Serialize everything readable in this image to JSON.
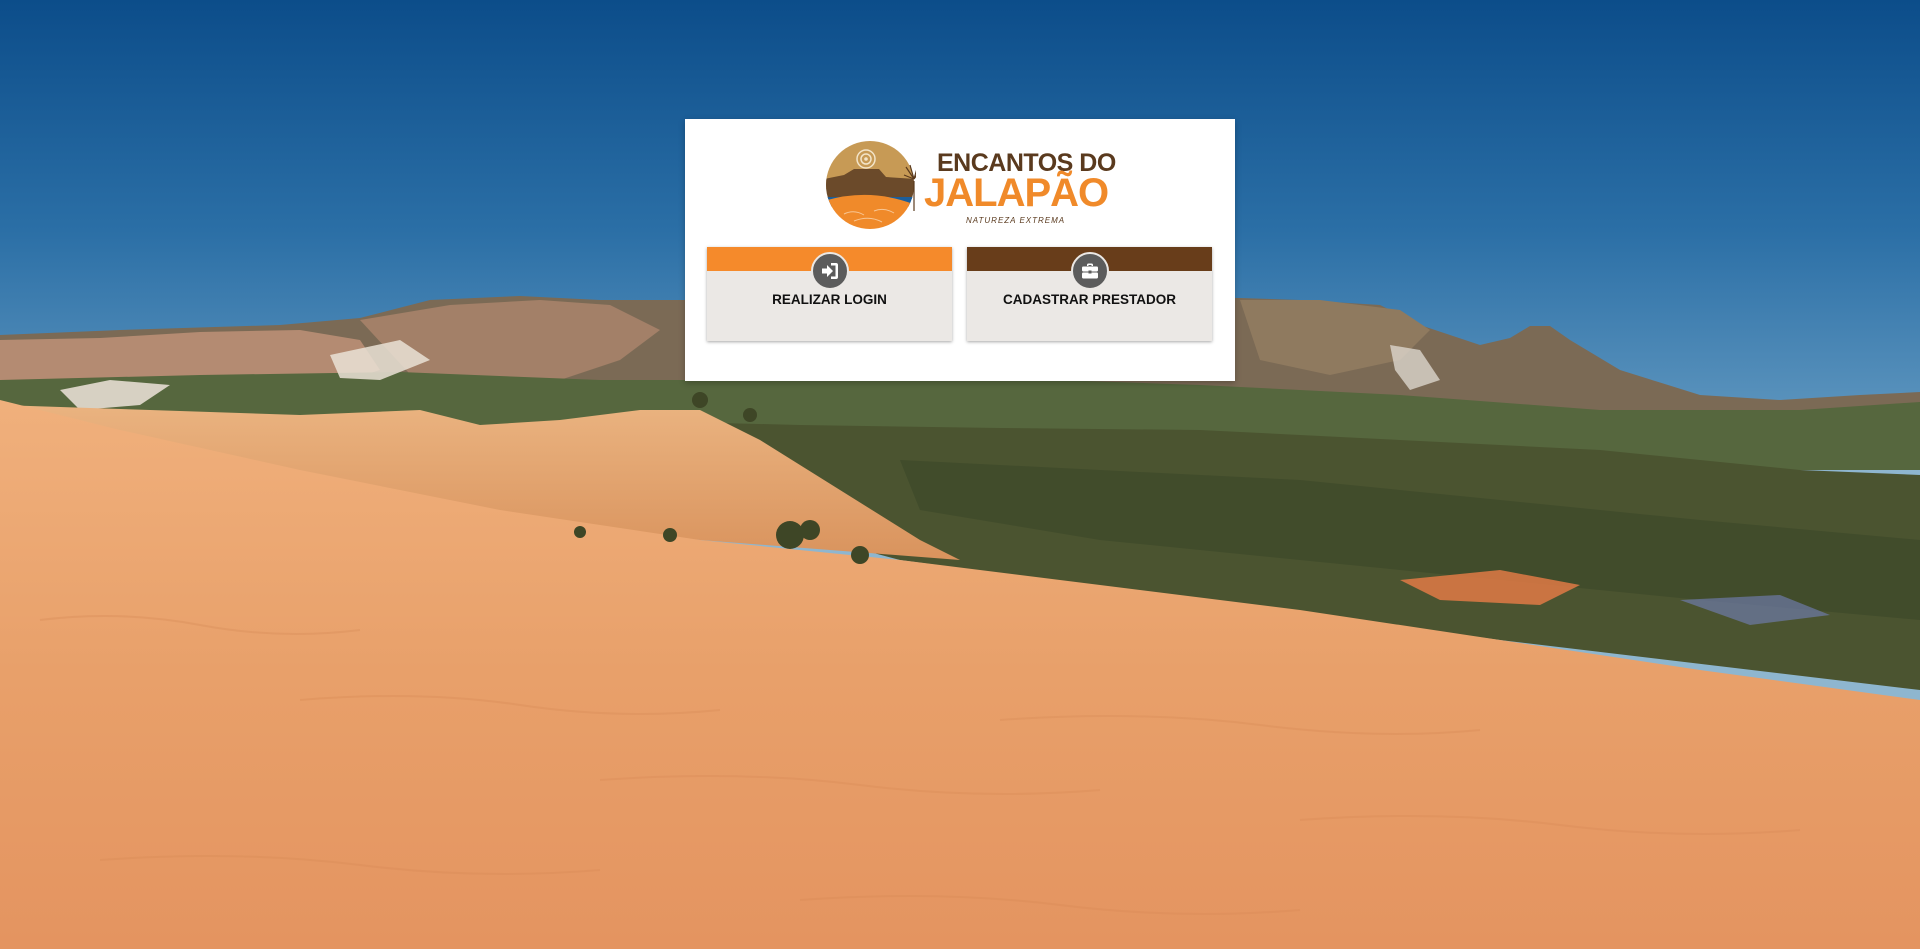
{
  "background": {
    "icon": "jalapao-dunes-landscape",
    "sky_color": "#1a5f9a",
    "sand_color": "#e8a06a"
  },
  "logo": {
    "icon": "encantos-do-jalapao-logo",
    "line1": "ENCANTOS DO",
    "line2": "JALAPÃO",
    "tagline": "NATUREZA   EXTREMA"
  },
  "actions": {
    "login": {
      "label": "REALIZAR LOGIN",
      "icon": "sign-in-icon",
      "accent": "#f58a2b"
    },
    "register_provider": {
      "label": "CADASTRAR PRESTADOR",
      "icon": "briefcase-icon",
      "accent": "#683d1a"
    }
  }
}
